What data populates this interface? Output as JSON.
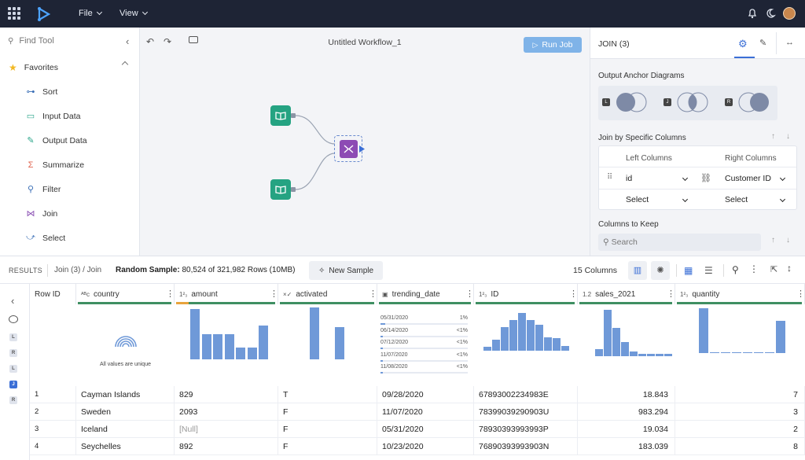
{
  "topbar": {
    "menu_file": "File",
    "menu_view": "View"
  },
  "tools": {
    "search_placeholder": "Find Tool",
    "section": "Favorites",
    "items": [
      {
        "label": "Sort",
        "icon": "sort-icon",
        "color": "#3b6fb6",
        "glyph": "⊶"
      },
      {
        "label": "Input Data",
        "icon": "book-icon",
        "color": "#2aa58a",
        "glyph": "▭"
      },
      {
        "label": "Output Data",
        "icon": "book-pen-icon",
        "color": "#2aa58a",
        "glyph": "✎"
      },
      {
        "label": "Summarize",
        "icon": "sigma-icon",
        "color": "#e0644f",
        "glyph": "Σ"
      },
      {
        "label": "Filter",
        "icon": "filter-icon",
        "color": "#3b6fb6",
        "glyph": "⚲"
      },
      {
        "label": "Join",
        "icon": "join-icon",
        "color": "#8a4fb3",
        "glyph": "⋈"
      },
      {
        "label": "Select",
        "icon": "select-icon",
        "color": "#3b6fb6",
        "glyph": "⤻"
      }
    ]
  },
  "canvas": {
    "title": "Untitled Workflow_1",
    "run_label": "Run Job"
  },
  "config": {
    "title": "JOIN (3)",
    "anchor_title": "Output Anchor Diagrams",
    "anchors": [
      "L",
      "J",
      "R"
    ],
    "join_title": "Join by Specific Columns",
    "left_cols": "Left Columns",
    "right_cols": "Right Columns",
    "row1_left": "id",
    "row1_right": "Customer ID",
    "row2_left": "Select",
    "row2_right": "Select",
    "keep_title": "Columns to Keep",
    "search_placeholder": "Search"
  },
  "results": {
    "label": "RESULTS",
    "breadcrumb": "Join (3) / Join",
    "sample_label": "Random Sample:",
    "sample_value": "80,524 of 321,982 Rows (10MB)",
    "new_sample": "New Sample",
    "columns_count": "15 Columns"
  },
  "rail": {
    "chips": [
      "L",
      "R",
      "L",
      "J",
      "R"
    ]
  },
  "table": {
    "row_id_header": "Row ID",
    "columns": [
      {
        "name": "country",
        "type": "ABC",
        "bar_color": "#3f8f62"
      },
      {
        "name": "amount",
        "type": "123",
        "bar_color": "#e8a33c"
      },
      {
        "name": "activated",
        "type": "×✓",
        "bar_color": "#3f8f62"
      },
      {
        "name": "trending_date",
        "type": "cal",
        "bar_color": "#3f8f62"
      },
      {
        "name": "ID",
        "type": "123",
        "bar_color": "#3f8f62"
      },
      {
        "name": "sales_2021",
        "type": "1.2",
        "bar_color": "#3f8f62"
      },
      {
        "name": "quantity",
        "type": "123",
        "bar_color": "#3f8f62"
      }
    ],
    "unique_label": "All values are unique",
    "dates": [
      {
        "date": "05/31/2020",
        "pct": "1%"
      },
      {
        "date": "06/14/2020",
        "pct": "<1%"
      },
      {
        "date": "07/12/2020",
        "pct": "<1%"
      },
      {
        "date": "11/07/2020",
        "pct": "<1%"
      },
      {
        "date": "11/08/2020",
        "pct": "<1%"
      }
    ],
    "hist_amount": [
      0.97,
      0.48,
      0.48,
      0.48,
      0.23,
      0.23,
      0.65
    ],
    "hist_activated": [
      1.0,
      0.62
    ],
    "hist_id": [
      0.09,
      0.26,
      0.54,
      0.7,
      0.88,
      0.7,
      0.6,
      0.31,
      0.29,
      0.1
    ],
    "hist_sales": [
      0.15,
      0.95,
      0.58,
      0.29,
      0.09,
      0.05,
      0.05,
      0.05,
      0.05
    ],
    "hist_quantity": [
      0.98,
      0.02,
      0.02,
      0.02,
      0.02,
      0.02,
      0.02,
      0.7
    ],
    "rows": [
      [
        "1",
        "Cayman Islands",
        "829",
        "T",
        "09/28/2020",
        "67893002234983E",
        "18.843",
        "7"
      ],
      [
        "2",
        "Sweden",
        "2093",
        "F",
        "11/07/2020",
        "78399039290903U",
        "983.294",
        "3"
      ],
      [
        "3",
        "Iceland",
        "[Null]",
        "F",
        "05/31/2020",
        "78930393993993P",
        "19.034",
        "2"
      ],
      [
        "4",
        "Seychelles",
        "892",
        "F",
        "10/23/2020",
        "76890393993903N",
        "183.039",
        "8"
      ]
    ]
  }
}
